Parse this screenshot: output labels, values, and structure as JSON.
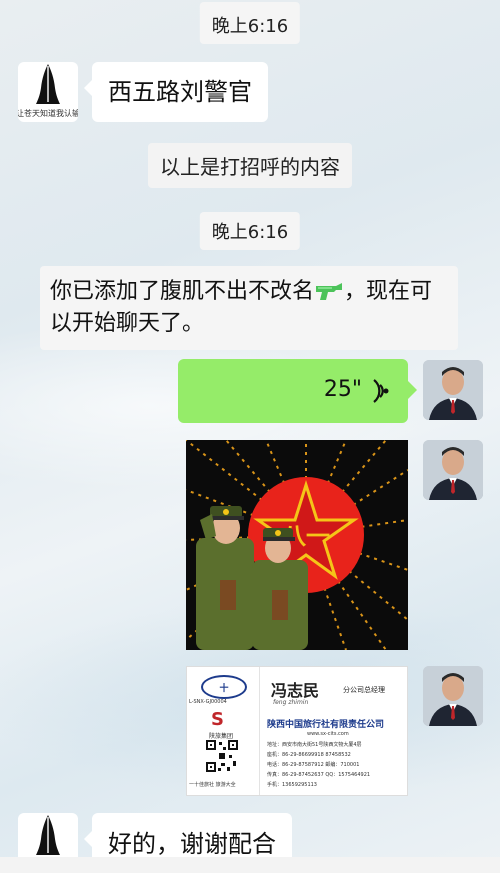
{
  "chat": {
    "time1": "晚上6:16",
    "contact_name_msg": "西五路刘警官",
    "greeting_note": "以上是打招呼的内容",
    "time2": "晚上6:16",
    "added_msg_part1": "你已添加了腹肌不出不改名",
    "added_msg_part2": "，现在可以开始聊天了。",
    "voice_duration": "25\"",
    "last_msg": "好的，谢谢配合"
  },
  "avatar_left": {
    "caption": "让苍天知道我认输"
  },
  "business_card": {
    "company_logo_text": "L-SNX-GJ00004",
    "name": "冯志民",
    "name_pinyin": "feng zhimin",
    "title": "分公司总经理",
    "company": "陕西中国旅行社有限责任公司",
    "website": "www.sx-cits.com",
    "address": "地址：西安市南大街51号陕西文物大厦4层",
    "phone1": "座机：86-29-86699918  87458532",
    "phone2": "电话：86-29-87587912  邮编：710001",
    "fax": "传真：86-29-87452637  QQ：1575464921",
    "mobile": "手机：13659295113",
    "group": "陕旅集团",
    "footer": "一十佳旅社  旅游大全"
  },
  "colors": {
    "voice_bubble": "#95ec69",
    "poster_red": "#e8231b",
    "poster_gold": "#f5c518"
  }
}
